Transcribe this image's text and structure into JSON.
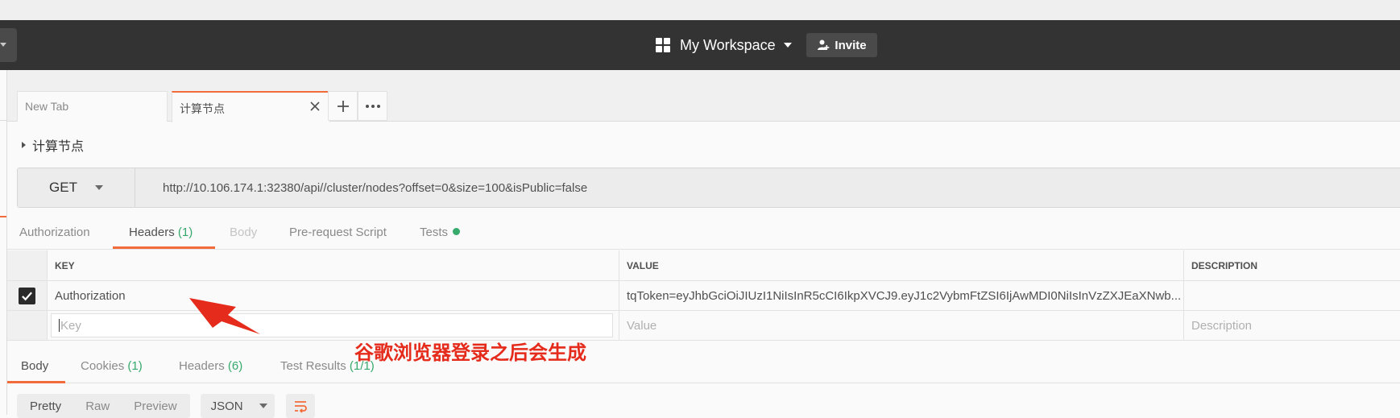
{
  "colors": {
    "accent": "#f26b3a",
    "success": "#36a96b",
    "annotation": "#e52b1b",
    "appbar": "#333333"
  },
  "header": {
    "workspace_icon": "grid-icon",
    "workspace_label": "My Workspace",
    "invite_label": "Invite",
    "invite_icon": "add-person-icon"
  },
  "tabs": {
    "items": [
      {
        "label": "New Tab"
      },
      {
        "label": "计算节点"
      }
    ],
    "close_icon": "close-icon",
    "add_icon": "plus-icon",
    "more_icon": "more-icon"
  },
  "request": {
    "name": "计算节点",
    "method": "GET",
    "url": "http://10.106.174.1:32380/api//cluster/nodes?offset=0&size=100&isPublic=false"
  },
  "request_tabs": {
    "authorization": "Authorization",
    "headers": "Headers",
    "headers_count": "(1)",
    "body": "Body",
    "prerequest": "Pre-request Script",
    "tests": "Tests"
  },
  "headers_table": {
    "columns": {
      "key": "KEY",
      "value": "VALUE",
      "description": "DESCRIPTION"
    },
    "rows": [
      {
        "checked": true,
        "key": "Authorization",
        "value": "tqToken=eyJhbGciOiJIUzI1NiIsInR5cCI6IkpXVCJ9.eyJ1c2VybmFtZSI6IjAwMDI0NiIsInVzZXJEaXNwb...",
        "description": ""
      }
    ],
    "placeholders": {
      "key": "Key",
      "value": "Value",
      "description": "Description"
    }
  },
  "annotation": {
    "text": "谷歌浏览器登录之后会生成"
  },
  "response_tabs": {
    "body": "Body",
    "cookies": "Cookies",
    "cookies_count": "(1)",
    "headers": "Headers",
    "headers_count": "(6)",
    "tests": "Test Results",
    "tests_count": "(1/1)"
  },
  "response_controls": {
    "pretty": "Pretty",
    "raw": "Raw",
    "preview": "Preview",
    "format": "JSON",
    "wrap_icon": "wrap-lines-icon"
  }
}
